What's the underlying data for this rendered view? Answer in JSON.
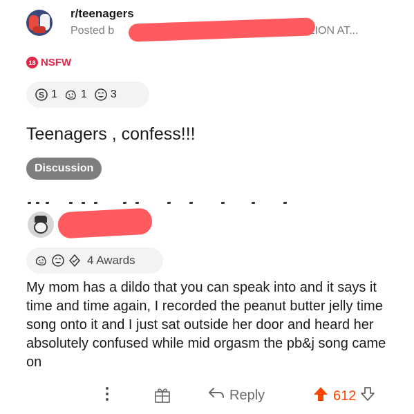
{
  "post": {
    "subreddit": "r/teenagers",
    "posted_by_prefix": "Posted b",
    "posted_by_suffix": "MILLION AT...",
    "nsfw_badge": "18",
    "nsfw_label": "NSFW",
    "awards": [
      {
        "icon": "silver-award-icon",
        "count": "1"
      },
      {
        "icon": "wholesome-award-icon",
        "count": "1"
      },
      {
        "icon": "laughing-award-icon",
        "count": "3"
      }
    ],
    "title": "Teenagers , confess!!!",
    "flair": "Discussion"
  },
  "comment": {
    "awards_label": "4 Awards",
    "body": "My mom has a dildo that you can speak into and it says it time and time again, I recorded the peanut butter jelly time song onto it and I just sat outside her door and heard her absolutely confused while mid orgasm the pb&j song came on"
  },
  "actions": {
    "reply_label": "Reply",
    "vote_count": "612"
  },
  "colors": {
    "upvote": "#ff4500",
    "nsfw": "#e0284a",
    "redaction": "#ff5a5f"
  }
}
